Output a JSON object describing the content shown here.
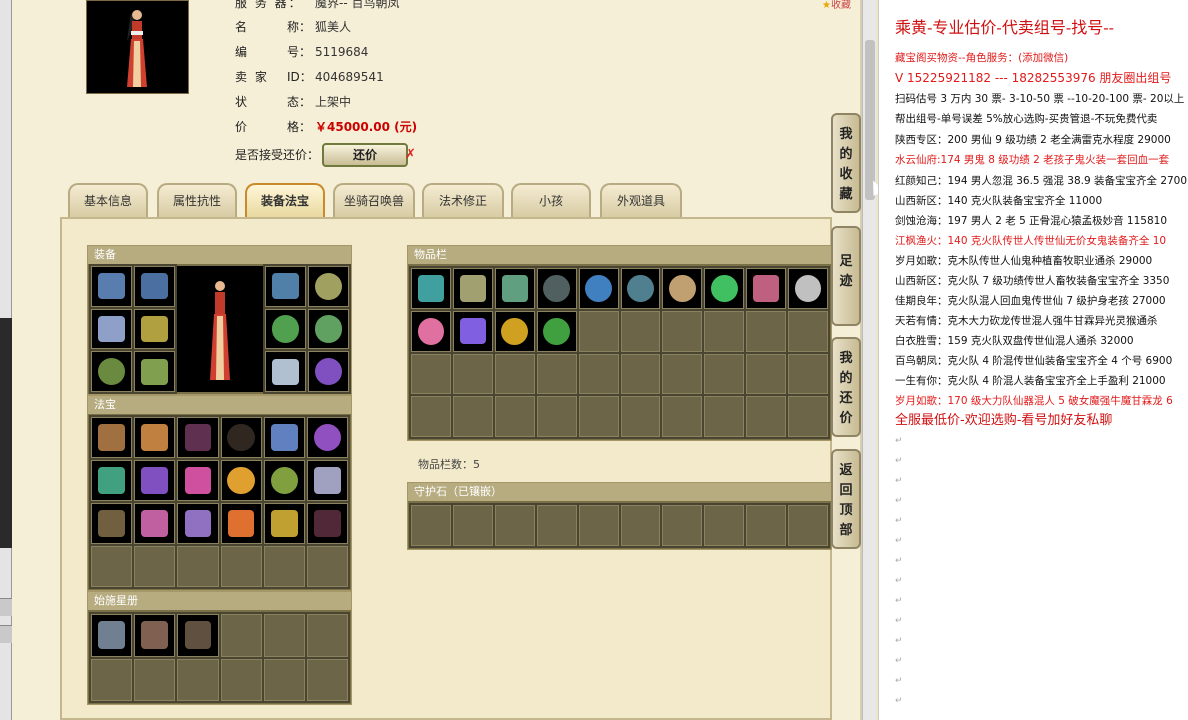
{
  "item_info": {
    "server_label": "服 务 器：",
    "server_value": "魔界-- 百鸟朝凤",
    "name_label": "名",
    "name_label2": "称：",
    "name_value": "狐美人",
    "id_label": "编",
    "id_label2": "号：",
    "id_value": "5119684",
    "seller_label": "卖 家",
    "seller_label2": "ID：",
    "seller_value": "404689541",
    "status_label": "状",
    "status_label2": "态：",
    "status_value": "上架中",
    "price_label": "价",
    "price_label2": "格：",
    "price_value": "￥45000.00 (元)",
    "haggle_label": "是否接受还价：",
    "haggle_button": "还价",
    "haggle_x": "✗",
    "fav_label": "收藏"
  },
  "tabs": [
    {
      "label": "基本信息",
      "active": false
    },
    {
      "label": "属性抗性",
      "active": false
    },
    {
      "label": "装备法宝",
      "active": true
    },
    {
      "label": "坐骑召唤兽",
      "active": false
    },
    {
      "label": "法术修正",
      "active": false
    },
    {
      "label": "小孩",
      "active": false
    },
    {
      "label": "外观道具",
      "active": false
    }
  ],
  "panels": {
    "equipment": "装备",
    "treasure": "法宝",
    "atlas": "始施星册",
    "inventory": "物品栏",
    "inventory_count": "物品栏数：5",
    "guard_stone": "守护石（已镶嵌）"
  },
  "side_tabs": {
    "favorites": "我的收藏",
    "footprints": "足迹",
    "my_offers": "我的还价",
    "back_top": "返回顶部"
  },
  "right_pane": {
    "title": "乘黄-专业估价-代卖组号-找号--",
    "lines": [
      {
        "text": "藏宝阁买物资--角色服务：(添加微信)",
        "color": "red"
      },
      {
        "text": "V 15225921182 --- 18282553976 朋友圈出组号",
        "color": "red"
      },
      {
        "text": "扫码估号 3 万内 30 票- 3-10-50 票 --10-20-100 票- 20以上 1",
        "color": "black"
      },
      {
        "text": "帮出组号-单号误差 5%放心选购-买贵管退-不玩免费代卖",
        "color": "black"
      },
      {
        "text": "陕西专区：200 男仙 9 级功绩 2 老全满雷克水程度 29000",
        "color": "black"
      },
      {
        "text": "水云仙府:174 男鬼 8 级功绩 2 老孩子鬼火装一套回血一套",
        "color": "red"
      },
      {
        "text": "红颜知己：194 男人忽混 36.5 强混 38.9 装备宝宝齐全 2700",
        "color": "black"
      },
      {
        "text": "山西新区：140 克火队装备宝宝齐全 11000",
        "color": "black"
      },
      {
        "text": "剑蚀沧海：197 男人 2 老 5 正骨混心猿孟极妙音 115810",
        "color": "black"
      },
      {
        "text": "江枫渔火：140 克火队传世人传世仙无价女鬼装备齐全 10",
        "color": "red"
      },
      {
        "text": "岁月如歌：克木队传世人仙鬼种植畜牧职业通杀 29000",
        "color": "black"
      },
      {
        "text": "山西新区：克火队 7 级功绩传世人畜牧装备宝宝齐全 3350",
        "color": "black"
      },
      {
        "text": "佳期良年：克火队混人回血鬼传世仙 7 级护身老孩 27000",
        "color": "black"
      },
      {
        "text": "天若有情：克木大力砍龙传世混人强牛甘霖异光灵猴通杀",
        "color": "black"
      },
      {
        "text": "白衣胜雪：159 克火队双盘传世仙混人通杀 32000",
        "color": "black"
      },
      {
        "text": "百鸟朝凤：克火队 4 阶混传世仙装备宝宝齐全 4 个号 6900",
        "color": "black"
      },
      {
        "text": "一生有你：克火队 4 阶混人装备宝宝齐全上手盈利 21000",
        "color": "black"
      },
      {
        "text": "岁月如歌：170 级大力队仙器混人 5 破女魔强牛魔甘霖龙 6",
        "color": "red"
      },
      {
        "text": "全服最低价-欢迎选购-看号加好友私聊",
        "color": "bigred"
      }
    ],
    "return_mark": "↵"
  },
  "colors": {
    "accent_red": "#d01010",
    "panel_olive": "#7a7048",
    "active_tab_border": "#c98a2a"
  }
}
